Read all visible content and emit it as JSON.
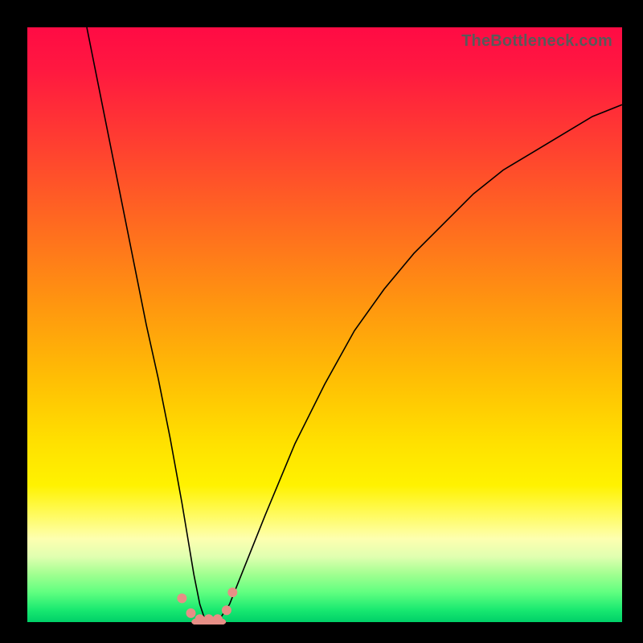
{
  "watermark": "TheBottleneck.com",
  "colors": {
    "frame": "#000000",
    "wm": "#595959",
    "curve": "#000000",
    "marker": "#e78f86"
  },
  "chart_data": {
    "type": "line",
    "title": "",
    "xlabel": "",
    "ylabel": "",
    "xlim": [
      0,
      100
    ],
    "ylim": [
      0,
      100
    ],
    "grid": false,
    "legend": false,
    "series": [
      {
        "name": "bottleneck-curve",
        "x": [
          10,
          12,
          14,
          16,
          18,
          20,
          22,
          24,
          26,
          27,
          28,
          29,
          30,
          32,
          34,
          36,
          40,
          45,
          50,
          55,
          60,
          65,
          70,
          75,
          80,
          85,
          90,
          95,
          100
        ],
        "y": [
          100,
          90,
          80,
          70,
          60,
          50,
          41,
          31,
          20,
          14,
          8,
          3,
          0,
          0,
          3,
          8,
          18,
          30,
          40,
          49,
          56,
          62,
          67,
          72,
          76,
          79,
          82,
          85,
          87
        ]
      }
    ],
    "markers": {
      "x": [
        26,
        27.5,
        29,
        30.5,
        32,
        33.5,
        34.5
      ],
      "y": [
        4,
        1.5,
        0.5,
        0.5,
        0.5,
        2,
        5
      ]
    },
    "min_region": {
      "x_start": 28,
      "x_end": 33,
      "y": 0
    }
  }
}
